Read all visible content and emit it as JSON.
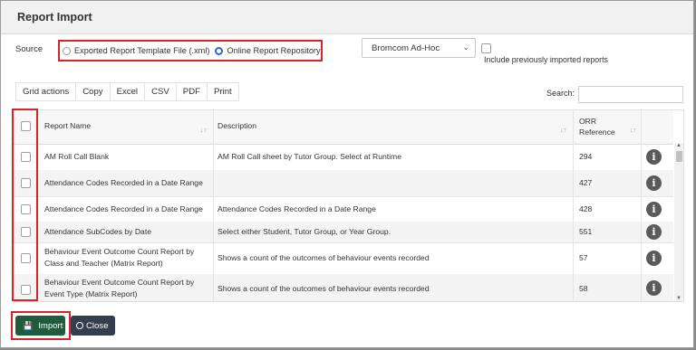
{
  "dialog": {
    "title": "Report Import"
  },
  "source": {
    "label": "Source",
    "options": [
      "Exported Report Template File (.xml)",
      "Online Report Repository"
    ],
    "selected": "Online Report Repository"
  },
  "repository_select": {
    "value": "Bromcom Ad-Hoc"
  },
  "include_previous": {
    "label": "Include previously imported reports",
    "checked": false
  },
  "toolbar": {
    "items": [
      "Grid actions",
      "Copy",
      "Excel",
      "CSV",
      "PDF",
      "Print"
    ]
  },
  "search": {
    "label": "Search:",
    "value": ""
  },
  "grid": {
    "headers": {
      "name": "Report Name",
      "description": "Description",
      "orr_line1": "ORR",
      "orr_line2": "Reference"
    },
    "rows": [
      {
        "name_l1": "AM Roll Call Blank",
        "name_l2": "",
        "description": "AM Roll Call sheet by Tutor Group. Select at Runtime",
        "orr": "294"
      },
      {
        "name_l1": "Attendance Codes Recorded in a Date Range",
        "name_l2": "",
        "description": "",
        "orr": "427"
      },
      {
        "name_l1": "Attendance Codes Recorded in a Date Range",
        "name_l2": "",
        "description": "Attendance Codes Recorded in a Date Range",
        "orr": "428"
      },
      {
        "name_l1": "Attendance SubCodes by Date",
        "name_l2": "",
        "description": "Select either Student, Tutor Group, or Year Group.",
        "orr": "551"
      },
      {
        "name_l1": "Behaviour Event Outcome Count Report by",
        "name_l2": "Class and Teacher (Matrix Report)",
        "description": "Shows a count of the outcomes of behaviour events recorded",
        "orr": "57"
      },
      {
        "name_l1": "Behaviour Event Outcome Count Report by",
        "name_l2": "Event Type (Matrix Report)",
        "description": "Shows a count of the outcomes of behaviour events recorded",
        "orr": "58"
      }
    ]
  },
  "buttons": {
    "import": "Import",
    "close": "Close"
  },
  "colors": {
    "highlight": "#d9242c",
    "import_button": "#1e5c3b",
    "close_button": "#333f4f",
    "radio_selected": "#2b65d9"
  }
}
